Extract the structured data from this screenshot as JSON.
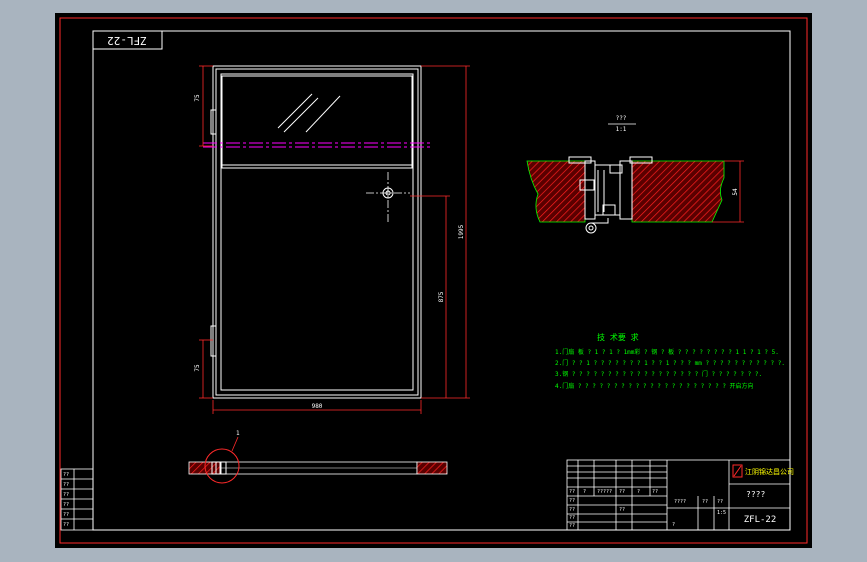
{
  "drawing": {
    "code_rotated": "ZFL-22",
    "code": "ZFL-22",
    "dims": {
      "top_panel": "75",
      "bottom_panel": "75",
      "total_height": "1995",
      "handle_height": "875",
      "width": "980"
    },
    "section_label": "???",
    "section_scale": "1:1",
    "section_height_dim": "54",
    "detail_callout": "1"
  },
  "notes": {
    "title": "技 术要 求",
    "lines": [
      "1.门扇  板 ? 1 ? 1   ?  1mm彩 ? 钢  ? 板 ? ? ? ? ? ? ? ? 1 1 ? 1 ? 5.",
      "2.门 ? ? 1 ? ?  ? ? ? ?  ? 1 ? ? 1 ? ?  ? mm ? ? ? ?   ? ? ? ? ? ? ?.",
      "3.钢  ? ? ? ? ? ? ? ? ? ?  ? ? ? ?  ? ? ? ? 门  ? ? ? ? ? ? ?.",
      "4.门扇  ? ? ? ? ? ? ? ? ? ? ? ? ? ? ? ? ? ? ? ? ? 开启方向"
    ]
  },
  "title_block": {
    "company": "江阴锦达昌公司",
    "name": "????",
    "drawing_no": "ZFL-22",
    "cells": [
      "??",
      "?",
      "?????",
      "??",
      "??",
      "?",
      "????",
      "??",
      "??",
      "?"
    ],
    "scale_cell": "1:5",
    "row_labels": [
      "??",
      "??",
      "??",
      "??",
      "??"
    ]
  },
  "revision_block": {
    "rows": [
      "??",
      "??",
      "??",
      "??",
      "??",
      "??"
    ]
  },
  "colors": {
    "viewport_bg": "#a9b4bf",
    "sheet_bg": "#000000",
    "border": "#ff0000",
    "linework": "#ffffff",
    "dimension": "#ff0000",
    "centerline": "#ff00ff",
    "text": "#ffffff",
    "notes_text": "#00ff00",
    "hatch": "#ff0000",
    "hatch_fill": "#6e0000"
  }
}
